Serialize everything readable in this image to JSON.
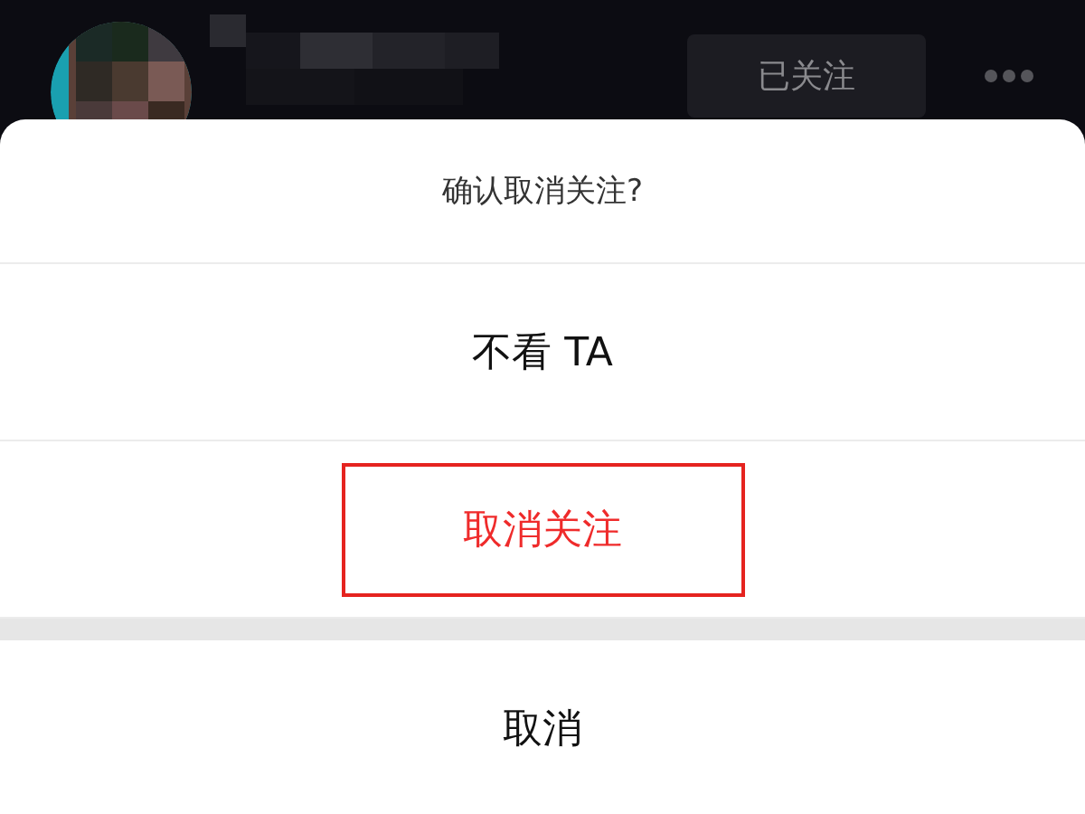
{
  "header": {
    "follow_button": "已关注"
  },
  "sheet": {
    "title": "确认取消关注?",
    "options": [
      {
        "label": "不看 TA",
        "kind": "normal"
      },
      {
        "label": "取消关注",
        "kind": "danger"
      }
    ],
    "cancel": "取消"
  }
}
